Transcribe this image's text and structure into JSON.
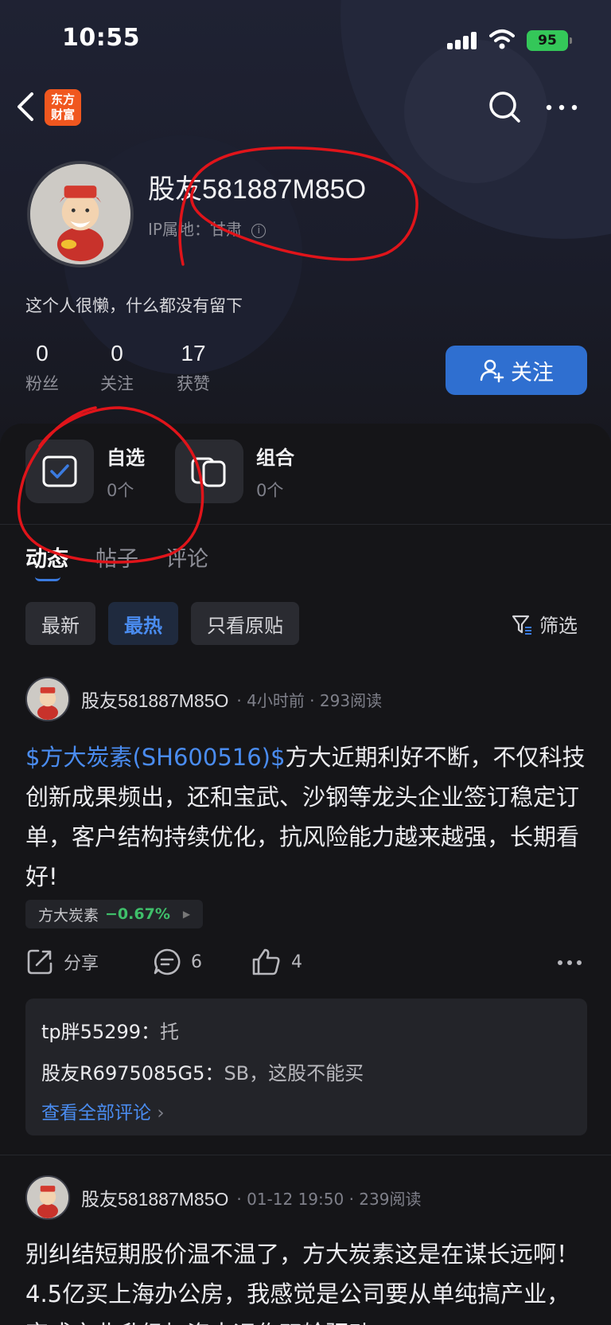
{
  "status_bar": {
    "time": "10:55",
    "battery": "95"
  },
  "nav": {
    "logo_line1": "东方",
    "logo_line2": "财富"
  },
  "profile": {
    "username": "股友581887M85O",
    "ip_label": "IP属地：甘肃",
    "bio": "这个人很懒，什么都没有留下",
    "stats": [
      {
        "num": "0",
        "label": "粉丝"
      },
      {
        "num": "0",
        "label": "关注"
      },
      {
        "num": "17",
        "label": "获赞"
      }
    ],
    "follow_label": "关注"
  },
  "quick": [
    {
      "title": "自选",
      "count": "0个",
      "icon": "checkbox-icon"
    },
    {
      "title": "组合",
      "count": "0个",
      "icon": "portfolio-icon"
    }
  ],
  "tabs": [
    {
      "label": "动态",
      "active": true
    },
    {
      "label": "帖子",
      "active": false
    },
    {
      "label": "评论",
      "active": false
    }
  ],
  "filters": {
    "chips": [
      "最新",
      "最热",
      "只看原贴"
    ],
    "active": "最热",
    "filter_label": "筛选"
  },
  "posts": [
    {
      "author": "股友581887M85O",
      "meta": "· 4小时前 · 293阅读",
      "stock_link": "$方大炭素(SH600516)$",
      "text": "方大近期利好不断，不仅科技创新成果频出，还和宝武、沙钢等龙头企业签订稳定订单，客户结构持续优化，抗风险能力越来越强，长期看好!",
      "ticker": {
        "name": "方大炭素",
        "change": "−0.67%"
      },
      "actions": {
        "share": "分享",
        "comments": "6",
        "likes": "4"
      },
      "replies": [
        {
          "user": "tp胖55299：",
          "text": "托"
        },
        {
          "user": "股友R6975085G5：",
          "text": "SB，这股不能买"
        }
      ],
      "view_all": "查看全部评论"
    },
    {
      "author": "股友581887M85O",
      "meta": "· 01-12 19:50 · 239阅读",
      "text": "别纠结短期股价温不温了，方大炭素这是在谋长远啊！4.5亿买上海办公房，我感觉是公司要从单纯搞产业，变成产业升级加资本运作双轮驱动"
    }
  ],
  "colors": {
    "accent": "#2f6fd0",
    "link": "#4a8cf0",
    "down": "#3fbf6a",
    "annotation": "#e0141a"
  }
}
